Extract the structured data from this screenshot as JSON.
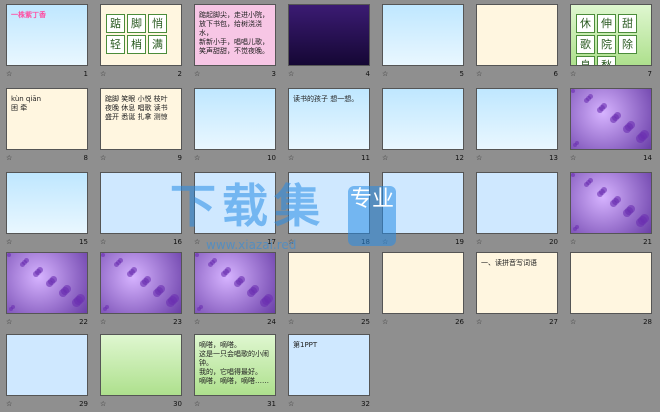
{
  "rows": [
    [
      {
        "n": "1",
        "t": "一株紫丁香",
        "cls": "sky",
        "hl": "#ff4fa3"
      },
      {
        "n": "2",
        "t": "",
        "cls": "cream",
        "chars": [
          "踮",
          "脚",
          "悄",
          "轻",
          "梢",
          "满"
        ]
      },
      {
        "n": "3",
        "t": "踮起脚尖，走进小院，\n放下书包，给树浇浇水，\n新新小手，唱唱儿歌，\n笑声甜甜，不觉夜晚。",
        "cls": "pink"
      },
      {
        "n": "4",
        "t": "",
        "cls": "dark"
      },
      {
        "n": "5",
        "t": "",
        "cls": "sky"
      },
      {
        "n": "6",
        "t": "",
        "cls": "cream"
      },
      {
        "n": "7",
        "t": "",
        "cls": "green",
        "chars": [
          "休",
          "伸",
          "甜",
          "歌",
          "院",
          "除",
          "息",
          "愁"
        ]
      }
    ],
    [
      {
        "n": "8",
        "t": "kùn qiān\n困 牵",
        "cls": "cream"
      },
      {
        "n": "9",
        "t": "踮脚 笑眼 小悦 枝叶\n夜晚 休息 唱歌 读书\n盛开 悉诞 扎拿 测惊",
        "cls": "cream"
      },
      {
        "n": "10",
        "t": "",
        "cls": "sky"
      },
      {
        "n": "11",
        "t": "读书的孩子 想一想。",
        "cls": "sky"
      },
      {
        "n": "12",
        "t": "",
        "cls": "sky"
      },
      {
        "n": "13",
        "t": "",
        "cls": "sky"
      },
      {
        "n": "14",
        "t": "",
        "cls": "purple"
      }
    ],
    [
      {
        "n": "15",
        "t": "",
        "cls": "sky"
      },
      {
        "n": "16",
        "t": "",
        "cls": "blue"
      },
      {
        "n": "17",
        "t": "",
        "cls": "blue"
      },
      {
        "n": "18",
        "t": "",
        "cls": "blue"
      },
      {
        "n": "19",
        "t": "",
        "cls": "blue"
      },
      {
        "n": "20",
        "t": "",
        "cls": "blue"
      },
      {
        "n": "21",
        "t": "",
        "cls": "purple"
      }
    ],
    [
      {
        "n": "22",
        "t": "",
        "cls": "purple"
      },
      {
        "n": "23",
        "t": "",
        "cls": "purple"
      },
      {
        "n": "24",
        "t": "",
        "cls": "purple"
      },
      {
        "n": "25",
        "t": "",
        "cls": "cream"
      },
      {
        "n": "26",
        "t": "",
        "cls": "cream"
      },
      {
        "n": "27",
        "t": "一、读拼音写词语",
        "cls": "cream"
      },
      {
        "n": "28",
        "t": "",
        "cls": "cream"
      }
    ],
    [
      {
        "n": "29",
        "t": "",
        "cls": "blue"
      },
      {
        "n": "30",
        "t": "",
        "cls": "green"
      },
      {
        "n": "31",
        "t": "嘀嗒，嘀嗒。\n这是一只会唱歌的小闹钟。\n我的，它唱得最好。\n嘀嗒，嘀嗒，嘀嗒……",
        "cls": "green"
      },
      {
        "n": "32",
        "t": "第1PPT",
        "cls": "blue"
      }
    ]
  ],
  "watermark": "下载集",
  "watermark_url": "www.xiazai.red",
  "badge": "专业"
}
